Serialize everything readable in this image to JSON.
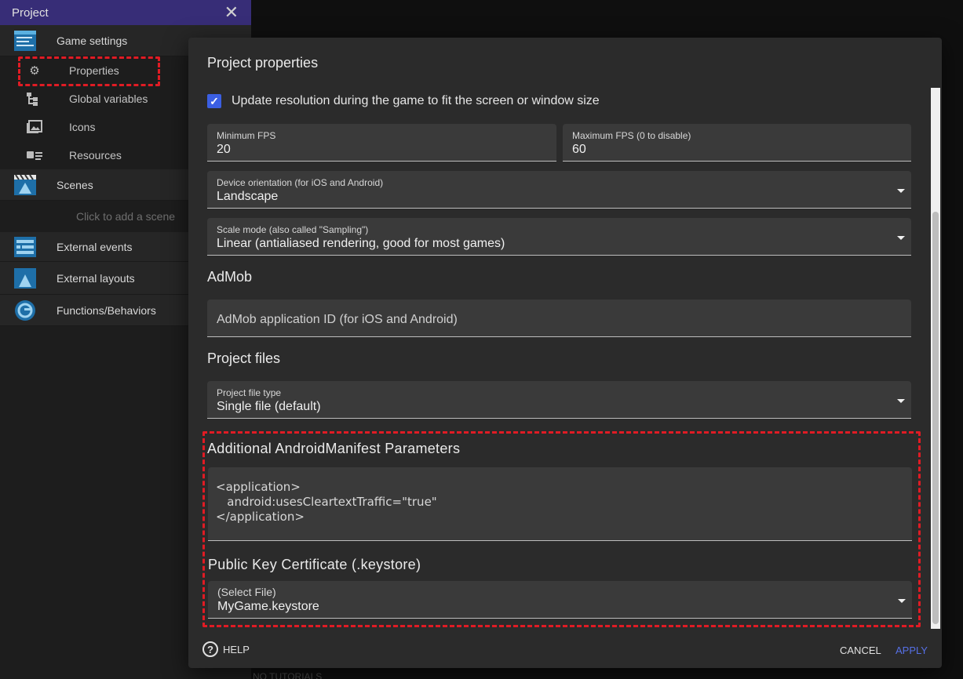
{
  "project_panel": {
    "title": "Project",
    "close_icon": "close-icon",
    "game_settings_label": "Game settings",
    "items": [
      {
        "label": "Properties",
        "icon": "gear-icon"
      },
      {
        "label": "Global variables",
        "icon": "hierarchy-icon"
      },
      {
        "label": "Icons",
        "icon": "image-icon"
      },
      {
        "label": "Resources",
        "icon": "resources-icon"
      }
    ],
    "scenes_label": "Scenes",
    "add_scene_label": "Click to add a scene",
    "external_events_label": "External events",
    "external_layouts_label": "External layouts",
    "functions_label": "Functions/Behaviors"
  },
  "dialog": {
    "title": "Project properties",
    "update_resolution_label": "Update resolution during the game to fit the screen or window size",
    "update_resolution_checked": true,
    "min_fps": {
      "label": "Minimum FPS",
      "value": "20"
    },
    "max_fps": {
      "label": "Maximum FPS (0 to disable)",
      "value": "60"
    },
    "orientation": {
      "label": "Device orientation (for iOS and Android)",
      "value": "Landscape"
    },
    "scale_mode": {
      "label": "Scale mode (also called \"Sampling\")",
      "value": "Linear (antialiased rendering, good for most games)"
    },
    "admob_section": "AdMob",
    "admob_placeholder": "AdMob application ID (for iOS and Android)",
    "project_files_section": "Project files",
    "file_type": {
      "label": "Project file type",
      "value": "Single file (default)"
    },
    "manifest_section": "Additional AndroidManifest Parameters",
    "manifest_lines": [
      "<application>",
      "   android:usesCleartextTraffic=\"true\"",
      "</application>"
    ],
    "keystore_section": "Public Key Certificate (.keystore)",
    "keystore": {
      "label": "(Select File)",
      "value": "MyGame.keystore"
    },
    "help_label": "HELP",
    "cancel_label": "CANCEL",
    "apply_label": "APPLY"
  },
  "background_text": "NO TUTORIALS",
  "colors": {
    "accent": "#3b5fe2",
    "apply": "#5670e6",
    "highlight": "#e01b24",
    "header": "#372d77"
  }
}
